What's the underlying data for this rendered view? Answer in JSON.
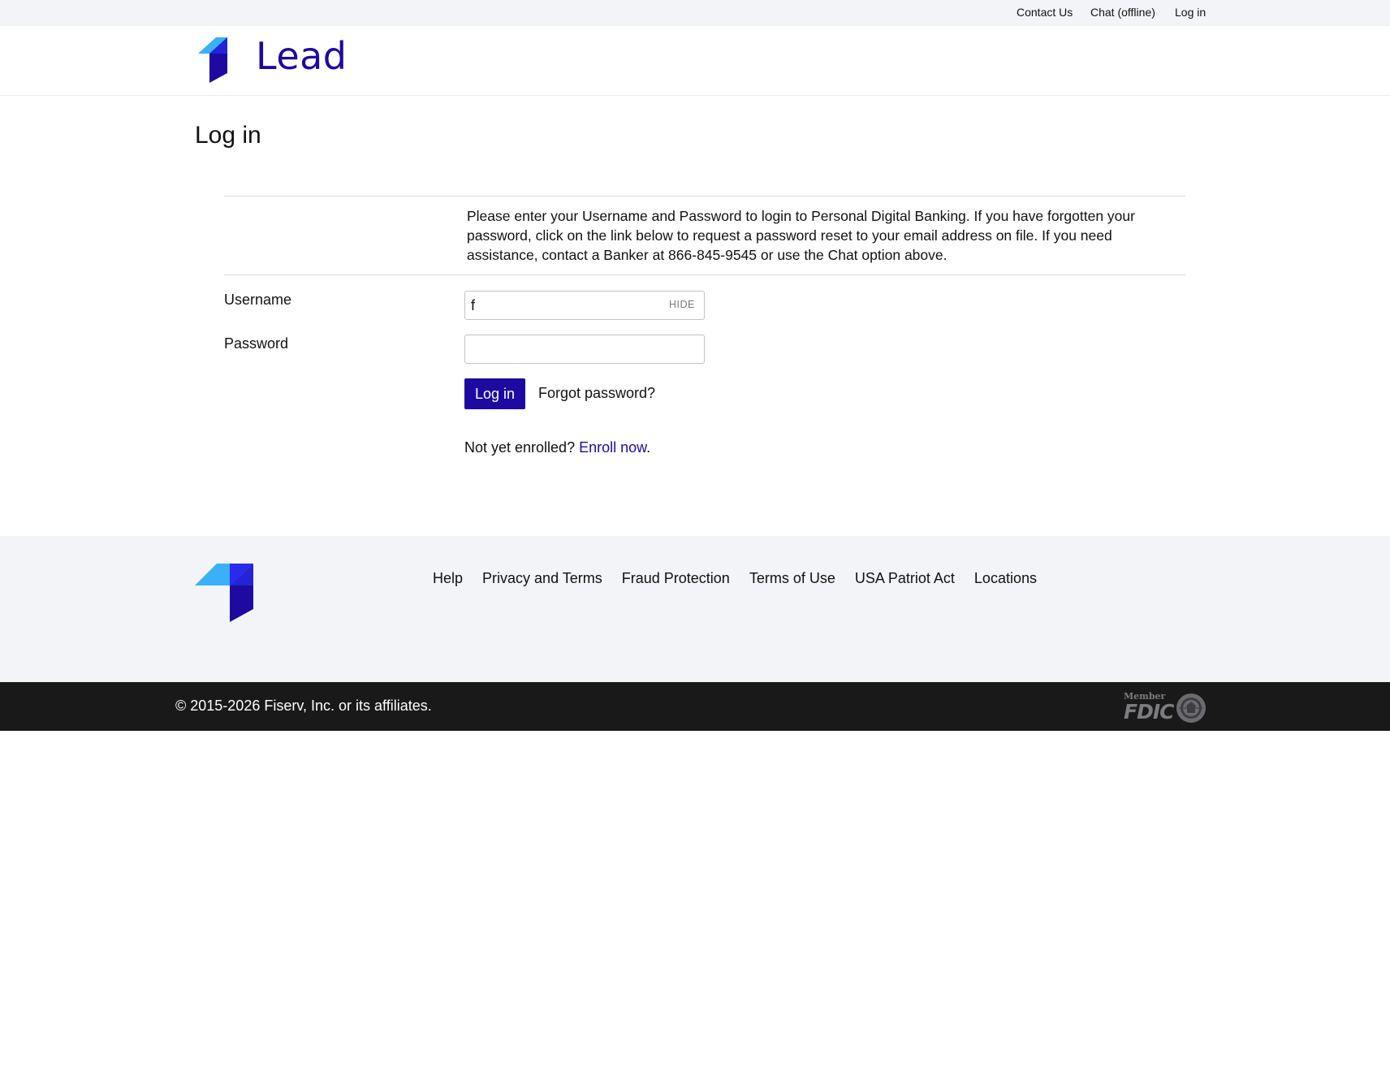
{
  "top_nav": {
    "contact": "Contact Us",
    "chat": "Chat (offline)",
    "login": "Log in"
  },
  "brand": {
    "name": "Lead",
    "primary_color": "#1e0aa0",
    "accent_light": "#3ab0f5",
    "accent_mid": "#2a2aee"
  },
  "page": {
    "title": "Log in"
  },
  "info": {
    "text": "Please enter your Username and Password to login to Personal Digital Banking.  If you have forgotten your password, click on the link below to request a password reset to your email address on file. If you need assistance, contact a Banker at 866-845-9545 or use the Chat option above."
  },
  "form": {
    "username_label": "Username",
    "username_value": "f",
    "hide_label": "HIDE",
    "password_label": "Password",
    "password_value": "",
    "login_button": "Log in",
    "forgot_link": "Forgot password?",
    "enroll_prefix": "Not yet enrolled?",
    "enroll_link": "Enroll now",
    "enroll_suffix": "."
  },
  "footer": {
    "links": [
      "Help",
      "Privacy and Terms",
      "Fraud Protection",
      "Terms of Use",
      "USA Patriot Act",
      "Locations"
    ],
    "copyright": "© 2015-2026 Fiserv, Inc. or its affiliates.",
    "fdic_member": "Member",
    "fdic_text": "FDIC"
  },
  "icons": {
    "logo": "lead-logo-icon",
    "footer_logo": "lead-logo-icon",
    "seal": "equal-housing-seal-icon"
  }
}
